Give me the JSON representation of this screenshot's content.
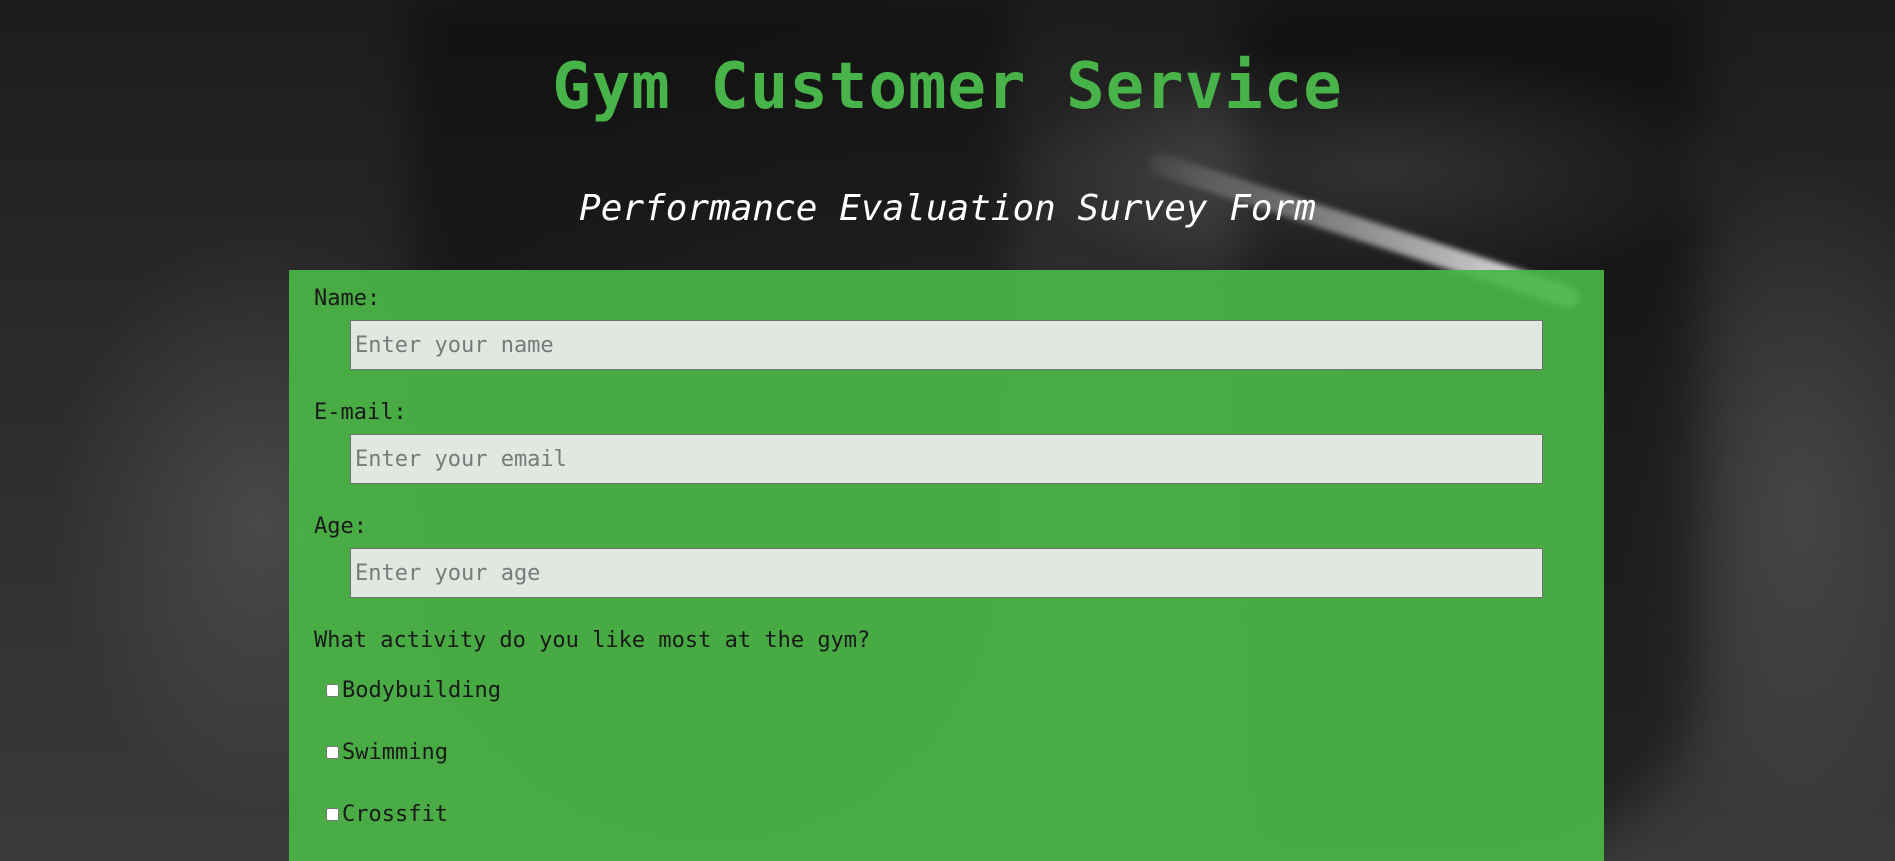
{
  "page": {
    "title": "Gym Customer Service",
    "subtitle": "Performance Evaluation Survey Form"
  },
  "form": {
    "name": {
      "label": "Name:",
      "placeholder": "Enter your name",
      "value": ""
    },
    "email": {
      "label": "E-mail:",
      "placeholder": "Enter your email",
      "value": ""
    },
    "age": {
      "label": "Age:",
      "placeholder": "Enter your age",
      "value": ""
    },
    "activity_question": "What activity do you like most at the gym?",
    "activities": [
      {
        "label": "Bodybuilding",
        "checked": false
      },
      {
        "label": "Swimming",
        "checked": false
      },
      {
        "label": "Crossfit",
        "checked": false
      }
    ]
  },
  "colors": {
    "accent_green": "#48b348",
    "form_background": "#4ab546",
    "subtitle": "#ffffff"
  }
}
